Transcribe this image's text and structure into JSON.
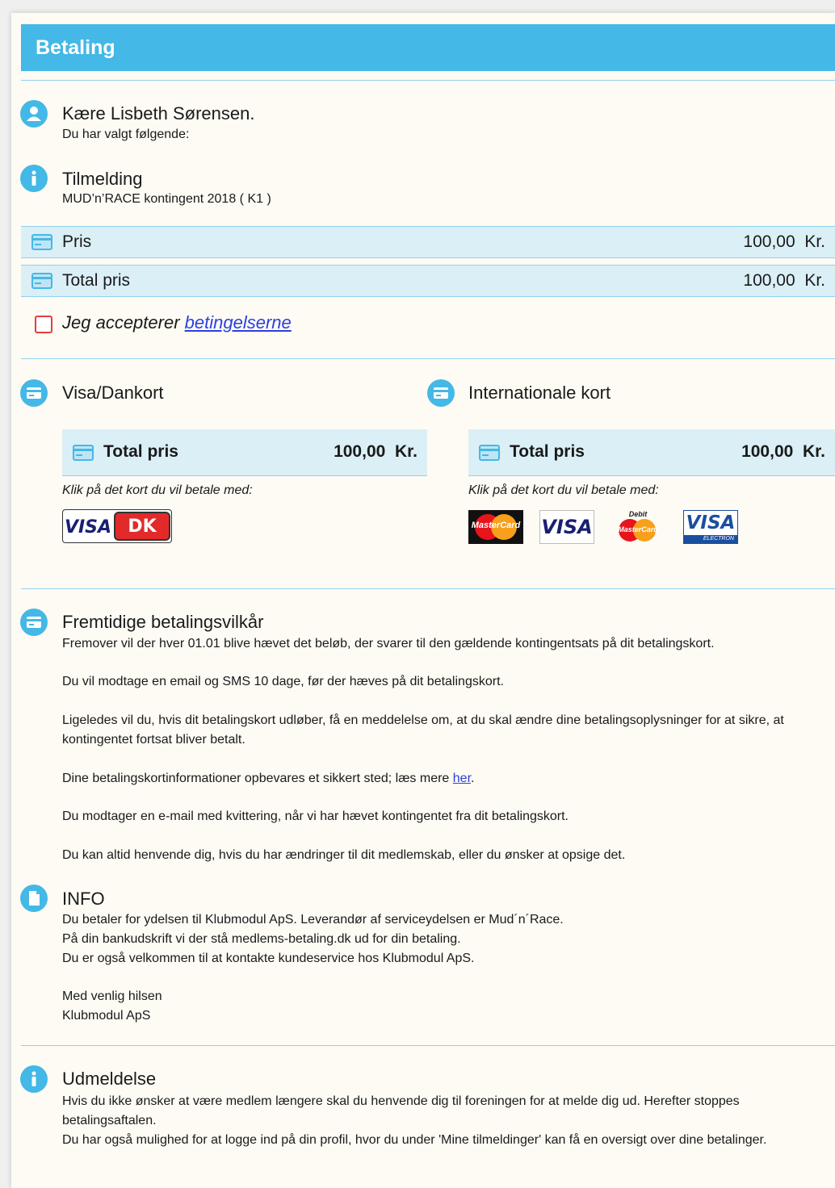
{
  "header": {
    "title": "Betaling"
  },
  "greeting": {
    "title": "Kære Lisbeth Sørensen.",
    "subtitle": "Du har valgt følgende:"
  },
  "registration": {
    "title": "Tilmelding",
    "detail": "MUD’n’RACE kontingent 2018 ( K1 )"
  },
  "price_rows": [
    {
      "label": "Pris",
      "amount": "100,00",
      "currency": "Kr."
    },
    {
      "label": "Total pris",
      "amount": "100,00",
      "currency": "Kr."
    }
  ],
  "terms": {
    "prefix": "Jeg accepterer ",
    "link": "betingelserne"
  },
  "payment": {
    "visa_dankort": {
      "title": "Visa/Dankort",
      "total_label": "Total pris",
      "total_amount": "100,00",
      "currency": "Kr.",
      "instruction": "Klik på det kort du vil betale med:",
      "cards": [
        "VISA",
        "DK"
      ]
    },
    "international": {
      "title": "Internationale kort",
      "total_label": "Total pris",
      "total_amount": "100,00",
      "currency": "Kr.",
      "instruction": "Klik på det kort du vil betale med:",
      "cards": [
        "MasterCard",
        "VISA",
        "Debit",
        "MasterCard",
        "VISA",
        "ELECTRON"
      ]
    }
  },
  "future_terms": {
    "title": "Fremtidige betalingsvilkår",
    "p1": "Fremover vil der hver  01.01  blive hævet det beløb, der svarer til den gældende kontingentsats på dit betalingskort.",
    "p2": "Du vil modtage en email og SMS 10 dage, før der hæves på dit betalingskort.",
    "p3": "Ligeledes vil du, hvis dit betalingskort udløber, få en meddelelse om, at du skal ændre dine betalingsoplysninger for at sikre, at kontingentet fortsat bliver betalt.",
    "p4_prefix": "Dine betalingskortinformationer opbevares et sikkert sted; læs mere ",
    "p4_link": "her",
    "p4_suffix": ".",
    "p5": "Du modtager en e-mail med kvittering, når vi har hævet kontingentet fra dit betalingskort.",
    "p6": "Du kan altid henvende dig, hvis du har ændringer til dit medlemskab, eller du ønsker at opsige det."
  },
  "info": {
    "title": "INFO",
    "l1": "Du betaler for ydelsen til Klubmodul ApS. Leverandør af serviceydelsen er Mud´n´Race.",
    "l2": "På din bankudskrift vi der stå medlems-betaling.dk ud for din betaling.",
    "l3": "Du er også velkommen til at kontakte kundeservice hos Klubmodul ApS.",
    "l4": "Med venlig hilsen",
    "l5": "Klubmodul ApS"
  },
  "unsubscribe": {
    "title": "Udmeldelse",
    "p1": "Hvis du ikke ønsker at være medlem længere skal du henvende dig til foreningen for at melde dig ud. Herefter stoppes betalingsaftalen.",
    "p2": "Du har også mulighed for at logge ind på din profil, hvor du under 'Mine tilmeldinger' kan få en oversigt over dine betalinger."
  },
  "colors": {
    "accent": "#44b8e6",
    "row_bg": "#dbeff6",
    "checkbox": "#e63d3d",
    "link": "#2a3fe0"
  }
}
